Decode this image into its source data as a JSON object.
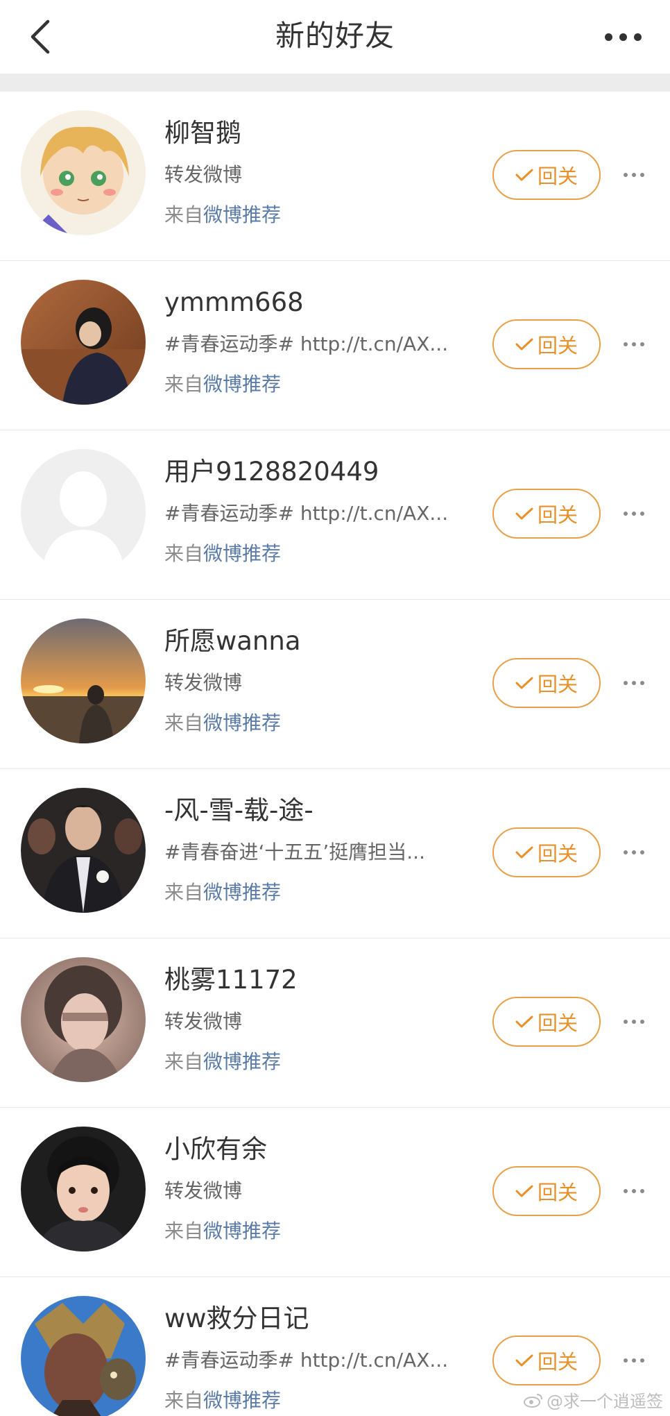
{
  "header": {
    "title": "新的好友",
    "back_icon": "chevron-left-icon",
    "more_icon": "more-horizontal-icon"
  },
  "colors": {
    "accent": "#e8902a",
    "link": "#5a7ba8",
    "text_primary": "#333333",
    "text_secondary": "#666666",
    "text_muted": "#8c8c8c",
    "band": "#ececec"
  },
  "list": {
    "source_prefix": "来自",
    "source_link": "微博推荐",
    "follow_label": "回关",
    "items": [
      {
        "name": "柳智鹅",
        "desc": "转发微博",
        "avatar": "anime-girl-avatar"
      },
      {
        "name": "ymmm668",
        "desc": "#青春运动季# http://t.cn/AX...",
        "avatar": "girl-photo-avatar"
      },
      {
        "name": "用户9128820449",
        "desc": "#青春运动季# http://t.cn/AX...",
        "avatar": "default-user-avatar"
      },
      {
        "name": "所愿wanna",
        "desc": "转发微博",
        "avatar": "sunset-avatar"
      },
      {
        "name": "-风-雪-载-途-",
        "desc": "#青春奋进‘十五五’挺膺担当...",
        "avatar": "man-in-suit-avatar"
      },
      {
        "name": "桃雾11172",
        "desc": "转发微博",
        "avatar": "blurred-girl-avatar"
      },
      {
        "name": "小欣有余",
        "desc": "转发微博",
        "avatar": "child-avatar"
      },
      {
        "name": "ww救分日记",
        "desc": "#青春运动季# http://t.cn/AX...",
        "avatar": "game-character-avatar"
      }
    ]
  },
  "watermark": "@求一个逍遥签"
}
